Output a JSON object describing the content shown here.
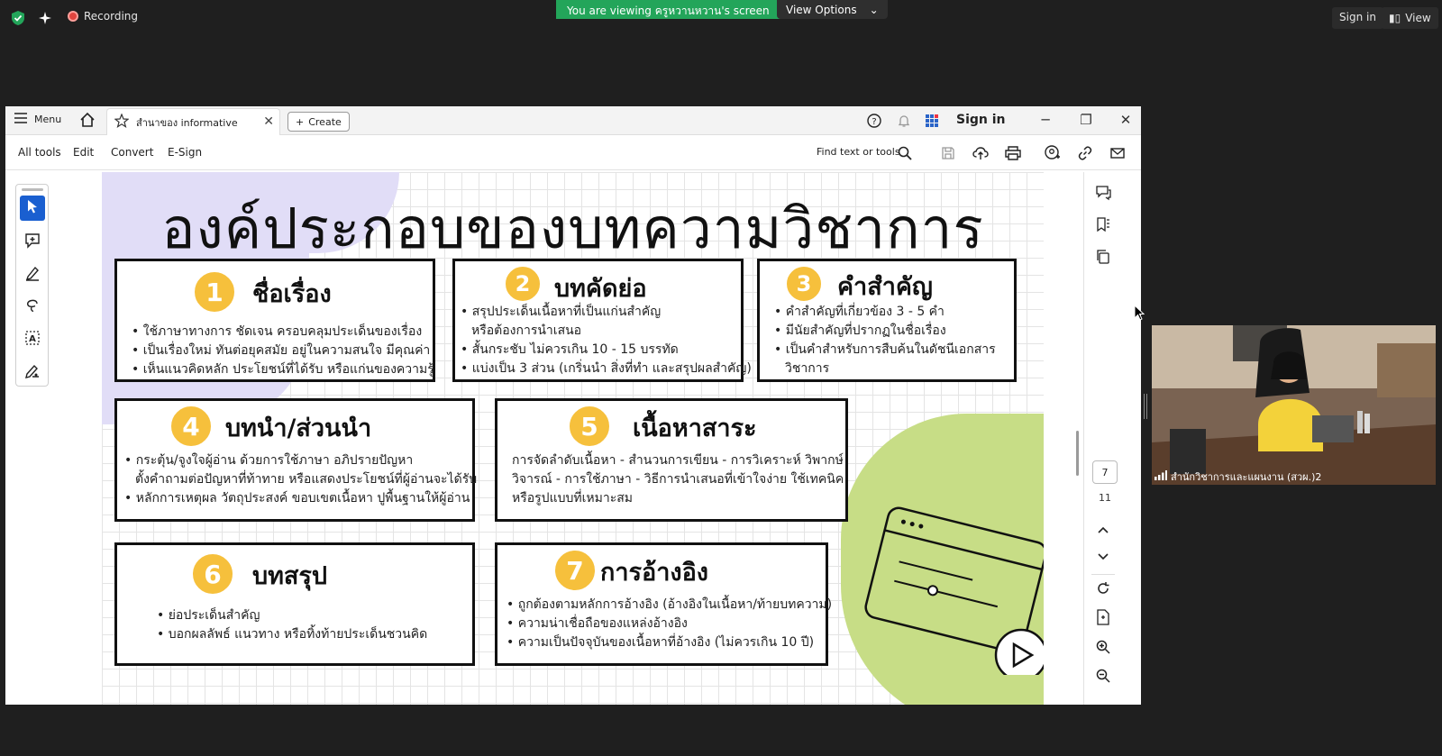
{
  "zoom": {
    "recording_label": "Recording",
    "viewing_banner": "You are viewing ครูหวานหวาน's screen",
    "view_options_label": "View Options",
    "sign_in_label": "Sign in",
    "view_label": "View",
    "participant_name": "สำนักวิชาการและแผนงาน (สวผ.)2"
  },
  "acrobat": {
    "menu_label": "Menu",
    "tab_title": "สำนาของ informative",
    "create_label": "Create",
    "sign_in_label": "Sign in",
    "tools": [
      "All tools",
      "Edit",
      "Convert",
      "E-Sign"
    ],
    "find_placeholder": "Find text or tools",
    "current_page": "7",
    "total_pages": "11"
  },
  "slide": {
    "title": "องค์ประกอบของบทความวิชาการ",
    "cards": [
      {
        "num": "1",
        "title": "ชื่อเรื่อง",
        "items": [
          "ใช้ภาษาทางการ ชัดเจน ครอบคลุมประเด็นของเรื่อง",
          "เป็นเรื่องใหม่ ทันต่อยุคสมัย อยู่ในความสนใจ มีคุณค่า",
          "เห็นแนวคิดหลัก ประโยชน์ที่ได้รับ หรือแก่นของความรู้"
        ]
      },
      {
        "num": "2",
        "title": "บทคัดย่อ",
        "items": [
          "สรุปประเด็นเนื้อหาที่เป็นแก่นสำคัญ",
          "หรือต้องการนำเสนอ",
          "สั้นกระชับ ไม่ควรเกิน 10 - 15 บรรทัด",
          "แบ่งเป็น 3 ส่วน (เกริ่นนำ สิ่งที่ทำ และสรุปผลสำคัญ)"
        ]
      },
      {
        "num": "3",
        "title": "คำสำคัญ",
        "items": [
          "คำสำคัญที่เกี่ยวข้อง 3 - 5 คำ",
          "มีนัยสำคัญที่ปรากฏในชื่อเรื่อง",
          "เป็นคำสำหรับการสืบค้นในดัชนีเอกสาร",
          "วิชาการ"
        ]
      },
      {
        "num": "4",
        "title": "บทนำ/ส่วนนำ",
        "items": [
          "กระตุ้น/จูงใจผู้อ่าน ด้วยการใช้ภาษา อภิปรายปัญหา",
          "ตั้งคำถามต่อปัญหาที่ท้าทาย หรือแสดงประโยชน์ที่ผู้อ่านจะได้รับ",
          "หลักการเหตุผล วัตถุประสงค์ ขอบเขตเนื้อหา ปูพื้นฐานให้ผู้อ่าน"
        ]
      },
      {
        "num": "5",
        "title": "เนื้อหาสาระ",
        "items": [
          "การจัดลำดับเนื้อหา - สำนวนการเขียน - การวิเคราะห์ วิพากษ์",
          "วิจารณ์ - การใช้ภาษา - วิธีการนำเสนอที่เข้าใจง่าย ใช้เทคนิค",
          "หรือรูปแบบที่เหมาะสม"
        ]
      },
      {
        "num": "6",
        "title": "บทสรุป",
        "items": [
          "ย่อประเด็นสำคัญ",
          "บอกผลลัพธ์ แนวทาง หรือทิ้งท้ายประเด็นชวนคิด"
        ]
      },
      {
        "num": "7",
        "title": "การอ้างอิง",
        "items": [
          "ถูกต้องตามหลักการอ้างอิง (อ้างอิงในเนื้อหา/ท้ายบทความ)",
          "ความน่าเชื่อถือของแหล่งอ้างอิง",
          "ความเป็นปัจจุบันของเนื้อหาที่อ้างอิง (ไม่ควรเกิน 10 ปี)"
        ]
      }
    ]
  },
  "colors": {
    "badge": "#f6c03c",
    "lavender": "#e1ddf7",
    "lime": "#c7dd86",
    "zoom_green": "#23a55a",
    "select_blue": "#1a5fd0"
  }
}
